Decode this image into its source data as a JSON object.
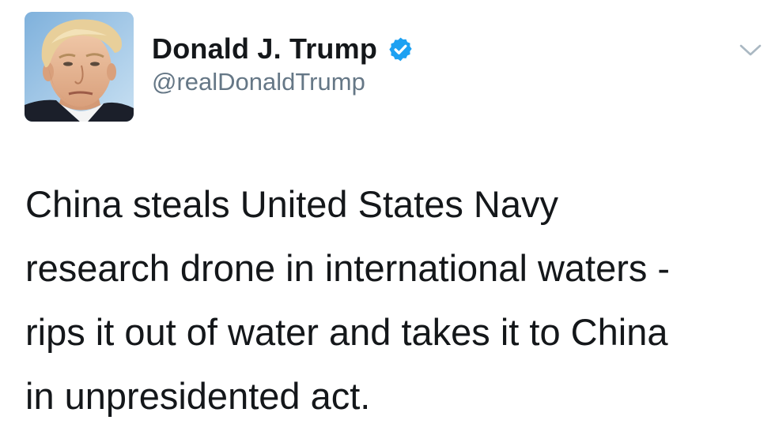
{
  "tweet": {
    "author": {
      "display_name": "Donald J. Trump",
      "handle": "@realDonaldTrump",
      "verified": true,
      "avatar_icon": "profile-photo"
    },
    "menu_icon": "chevron-down-icon",
    "text_lines": [
      "China steals United States Navy",
      "research drone in international waters -",
      "rips it out of water and takes it to China",
      "in unpresidented act."
    ]
  },
  "colors": {
    "text": "#14171a",
    "secondary_text": "#657786",
    "verified_badge": "#1da1f2",
    "chevron": "#aab8c2",
    "background": "#ffffff"
  }
}
